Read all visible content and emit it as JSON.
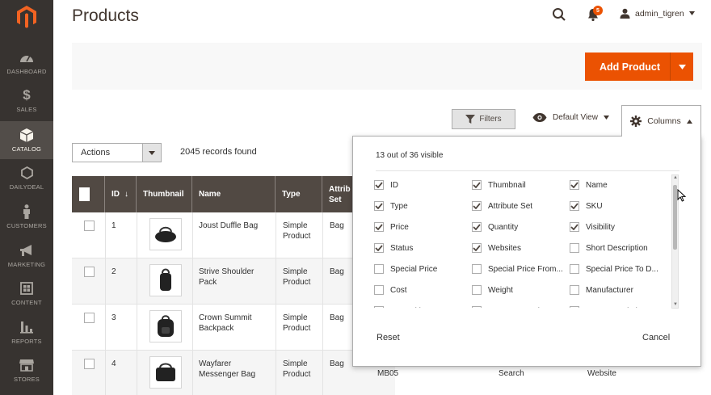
{
  "sidebar": {
    "items": [
      {
        "label": "DASHBOARD",
        "icon": "dashboard-icon"
      },
      {
        "label": "SALES",
        "icon": "dollar-icon"
      },
      {
        "label": "CATALOG",
        "icon": "box-icon"
      },
      {
        "label": "DAILYDEAL",
        "icon": "hexagon-icon"
      },
      {
        "label": "CUSTOMERS",
        "icon": "person-icon"
      },
      {
        "label": "MARKETING",
        "icon": "megaphone-icon"
      },
      {
        "label": "CONTENT",
        "icon": "content-icon"
      },
      {
        "label": "REPORTS",
        "icon": "bar-chart-icon"
      },
      {
        "label": "STORES",
        "icon": "store-icon"
      }
    ]
  },
  "header": {
    "title": "Products",
    "notifications_count": "5",
    "username": "admin_tigren"
  },
  "actions_bar": {
    "add_product": "Add Product"
  },
  "toolbar": {
    "filters": "Filters",
    "view": "Default View",
    "columns": "Columns",
    "actions": "Actions",
    "records": "2045 records found"
  },
  "grid": {
    "headers": [
      "ID",
      "Thumbnail",
      "Name",
      "Type",
      "Attrib Set"
    ],
    "rows": [
      {
        "id": "1",
        "name": "Joust Duffle Bag",
        "type": "Simple Product",
        "set": "Bag"
      },
      {
        "id": "2",
        "name": "Strive Shoulder Pack",
        "type": "Simple Product",
        "set": "Bag"
      },
      {
        "id": "3",
        "name": "Crown Summit Backpack",
        "type": "Simple Product",
        "set": "Bag"
      },
      {
        "id": "4",
        "name": "Wayfarer Messenger Bag",
        "type": "Simple Product",
        "set": "Bag"
      }
    ],
    "peek": {
      "sku": "MB05",
      "visibility": "Search",
      "websites": "Website"
    }
  },
  "columns_panel": {
    "summary": "13 out of 36 visible",
    "options": [
      {
        "label": "ID",
        "checked": true
      },
      {
        "label": "Thumbnail",
        "checked": true
      },
      {
        "label": "Name",
        "checked": true
      },
      {
        "label": "Type",
        "checked": true
      },
      {
        "label": "Attribute Set",
        "checked": true
      },
      {
        "label": "SKU",
        "checked": true
      },
      {
        "label": "Price",
        "checked": true
      },
      {
        "label": "Quantity",
        "checked": true
      },
      {
        "label": "Visibility",
        "checked": true
      },
      {
        "label": "Status",
        "checked": true
      },
      {
        "label": "Websites",
        "checked": true
      },
      {
        "label": "Short Description",
        "checked": false
      },
      {
        "label": "Special Price",
        "checked": false
      },
      {
        "label": "Special Price From...",
        "checked": false
      },
      {
        "label": "Special Price To D...",
        "checked": false
      },
      {
        "label": "Cost",
        "checked": false
      },
      {
        "label": "Weight",
        "checked": false
      },
      {
        "label": "Manufacturer",
        "checked": false
      },
      {
        "label": "Meta Title",
        "checked": false
      },
      {
        "label": "Meta Keywords",
        "checked": false
      },
      {
        "label": "Meta Description",
        "checked": false
      }
    ],
    "reset": "Reset",
    "cancel": "Cancel"
  },
  "colors": {
    "accent": "#eb5202",
    "sidebar": "#373330",
    "grid_header": "#514943"
  }
}
